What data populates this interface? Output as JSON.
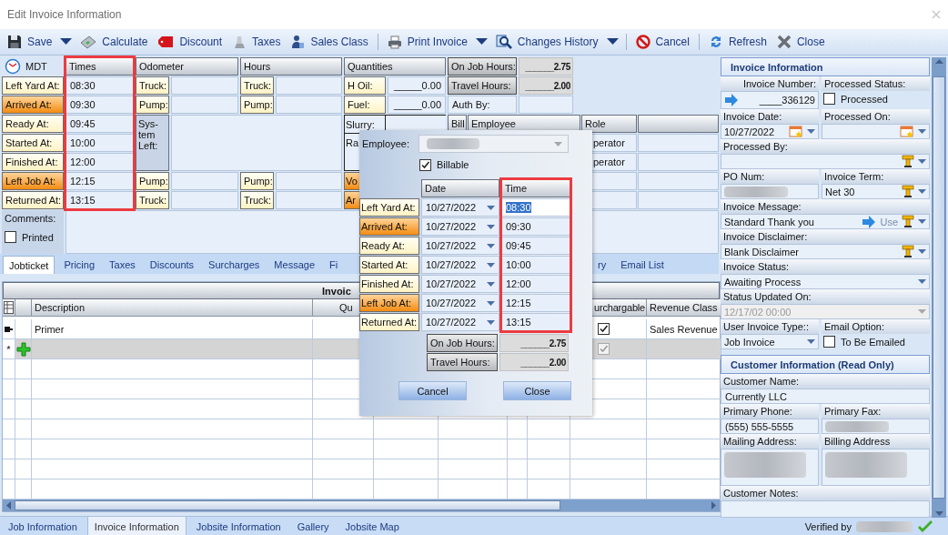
{
  "window": {
    "title": "Edit Invoice Information"
  },
  "toolbar": [
    {
      "kind": "button",
      "label": "Save"
    },
    {
      "kind": "caret"
    },
    {
      "kind": "button",
      "label": "Calculate"
    },
    {
      "kind": "button",
      "label": "Discount"
    },
    {
      "kind": "button",
      "label": "Taxes"
    },
    {
      "kind": "button",
      "label": "Sales Class"
    },
    {
      "kind": "separator"
    },
    {
      "kind": "button",
      "label": "Print Invoice"
    },
    {
      "kind": "caret"
    },
    {
      "kind": "button",
      "label": "Changes History"
    },
    {
      "kind": "caret"
    },
    {
      "kind": "separator"
    },
    {
      "kind": "button",
      "label": "Cancel"
    },
    {
      "kind": "separator"
    },
    {
      "kind": "button",
      "label": "Refresh"
    },
    {
      "kind": "button",
      "label": "Close"
    }
  ],
  "times": {
    "zone": "MDT",
    "framed": true,
    "columns": [
      "Times",
      "Odometer",
      "Hours",
      "Quantities"
    ],
    "events": [
      {
        "label": "Left Yard At:",
        "time": "08:30",
        "highlighted": false
      },
      {
        "label": "Arrived At:",
        "time": "09:30",
        "highlighted": true
      },
      {
        "label": "Ready At:",
        "time": "09:45",
        "highlighted": false
      },
      {
        "label": "Started At:",
        "time": "10:00",
        "highlighted": false
      },
      {
        "label": "Finished At:",
        "time": "12:00",
        "highlighted": false
      },
      {
        "label": "Left Job At:",
        "time": "12:15",
        "highlighted": true
      },
      {
        "label": "Returned At:",
        "time": "13:15",
        "highlighted": false
      }
    ]
  },
  "odometer": {
    "upper": [
      "Truck:",
      "Pump:"
    ],
    "system": "Sys-tem Left:",
    "lower": [
      "Pump:",
      "Truck:"
    ]
  },
  "hours": {
    "upper": [
      "Truck:",
      "Pump:"
    ],
    "lower": [
      "Pump:",
      "Truck:"
    ]
  },
  "quantities": {
    "upper": [
      {
        "label": "H Oil:",
        "value": "_____0.00"
      },
      {
        "label": "Fuel:",
        "value": "_____0.00"
      }
    ],
    "middle": [
      "Slurry:",
      "Ra"
    ],
    "lower": [
      {
        "label": "Vo",
        "highlighted": true
      },
      {
        "label": "Ar",
        "highlighted": true
      }
    ]
  },
  "totals": [
    {
      "kind": "total",
      "label": "On Job Hours:",
      "value": "______2.75"
    },
    {
      "kind": "total",
      "label": "Travel Hours:",
      "value": "______2.00"
    },
    {
      "kind": "field",
      "label": "Auth By:"
    }
  ],
  "crew": {
    "columns": [
      "Bill",
      "Employee",
      "Role"
    ],
    "rows": [
      {
        "role": "perator"
      },
      {
        "role": "perator"
      }
    ]
  },
  "comments": {
    "label": "Comments:",
    "printed": {
      "label": "Printed",
      "checked": false
    }
  },
  "detail_tabs": {
    "left": [
      {
        "label": "Jobticket",
        "selected": true
      },
      {
        "label": "Pricing",
        "selected": false
      },
      {
        "label": "Taxes",
        "selected": false
      },
      {
        "label": "Discounts",
        "selected": false
      },
      {
        "label": "Surcharges",
        "selected": false
      },
      {
        "label": "Message",
        "selected": false
      },
      {
        "label": "Fi",
        "selected": false
      }
    ],
    "right": [
      {
        "label": "ry",
        "selected": false
      },
      {
        "label": "Email List",
        "selected": false
      }
    ]
  },
  "items_grid": {
    "title": "Invoic",
    "columns": [
      "Description",
      "Qu",
      "urchargable",
      "Revenue Class"
    ],
    "rows": [
      {
        "description": "Primer",
        "surchargable": true,
        "revenue_class": "Sales Revenue"
      }
    ],
    "new_row": {
      "marker": "*",
      "surchargable": true,
      "disabled": true
    }
  },
  "time_popup": {
    "employee_label": "Employee:",
    "billable": {
      "label": "Billable",
      "checked": true
    },
    "framed": true,
    "columns": [
      "Date",
      "Time"
    ],
    "rows": [
      {
        "label": "Left Yard At:",
        "date": "10/27/2022",
        "time": "08:30",
        "highlighted": false,
        "selected": true
      },
      {
        "label": "Arrived At:",
        "date": "10/27/2022",
        "time": "09:30",
        "highlighted": true,
        "selected": false
      },
      {
        "label": "Ready At:",
        "date": "10/27/2022",
        "time": "09:45",
        "highlighted": false,
        "selected": false
      },
      {
        "label": "Started At:",
        "date": "10/27/2022",
        "time": "10:00",
        "highlighted": false,
        "selected": false
      },
      {
        "label": "Finished At:",
        "date": "10/27/2022",
        "time": "12:00",
        "highlighted": false,
        "selected": false
      },
      {
        "label": "Left Job At:",
        "date": "10/27/2022",
        "time": "12:15",
        "highlighted": true,
        "selected": false
      },
      {
        "label": "Returned At:",
        "date": "10/27/2022",
        "time": "13:15",
        "highlighted": false,
        "selected": false
      }
    ],
    "totals": [
      {
        "label": "On Job Hours:",
        "value": "______2.75"
      },
      {
        "label": "Travel Hours:",
        "value": "______2.00"
      }
    ],
    "buttons": [
      "Cancel",
      "Close"
    ]
  },
  "invoice_panel": {
    "title": "Invoice Information",
    "rows": [
      [
        {
          "kind": "number",
          "label": "Invoice Number:",
          "value": "____336129"
        },
        {
          "kind": "checkbox",
          "label": "Processed Status:",
          "text": "Processed",
          "checked": false
        }
      ],
      [
        {
          "kind": "date",
          "label": "Invoice Date:",
          "value": "10/27/2022"
        },
        {
          "kind": "date",
          "label": "Processed On:"
        }
      ],
      [
        {
          "kind": "picker",
          "label": "Processed By:"
        }
      ],
      [
        {
          "kind": "redacted",
          "label": "PO Num:"
        },
        {
          "kind": "picker",
          "label": "Invoice Term:",
          "value": "Net 30"
        }
      ],
      [
        {
          "kind": "message",
          "label": "Invoice Message:",
          "value": "Standard Thank you",
          "action": "Use"
        }
      ],
      [
        {
          "kind": "picker",
          "label": "Invoice Disclaimer:",
          "value": "Blank Disclaimer"
        }
      ],
      [
        {
          "kind": "dropdown",
          "label": "Invoice Status:",
          "value": "Awaiting Process",
          "disabled": false
        }
      ],
      [
        {
          "kind": "dropdown",
          "label": "Status Updated On:",
          "value": "12/17/02 00:00",
          "disabled": true
        }
      ],
      [
        {
          "kind": "dropdown",
          "label": "User Invoice Type::",
          "value": "Job Invoice",
          "disabled": false
        },
        {
          "kind": "checkbox",
          "label": "Email Option:",
          "text": "To Be Emailed",
          "checked": false
        }
      ]
    ]
  },
  "customer_panel": {
    "title": "Customer Information (Read Only)",
    "rows": [
      [
        {
          "kind": "text",
          "label": "Customer Name:",
          "value": "Currently LLC"
        }
      ],
      [
        {
          "kind": "text",
          "label": "Primary Phone:",
          "value": "(555) 555-5555"
        },
        {
          "kind": "redacted",
          "label": "Primary Fax:"
        }
      ],
      [
        {
          "kind": "redacted_tall",
          "label": "Mailing Address:"
        },
        {
          "kind": "redacted_tall",
          "label": "Billing Address"
        }
      ],
      [
        {
          "kind": "text",
          "label": "Customer Notes:"
        }
      ]
    ]
  },
  "bottom_tabs": [
    {
      "label": "Job Information",
      "selected": false
    },
    {
      "label": "Invoice Information",
      "selected": true
    },
    {
      "label": "Jobsite Information",
      "selected": false
    },
    {
      "label": "Gallery",
      "selected": false
    },
    {
      "label": "Jobsite Map",
      "selected": false
    }
  ],
  "status_bar": {
    "verified_label": "Verified by"
  }
}
